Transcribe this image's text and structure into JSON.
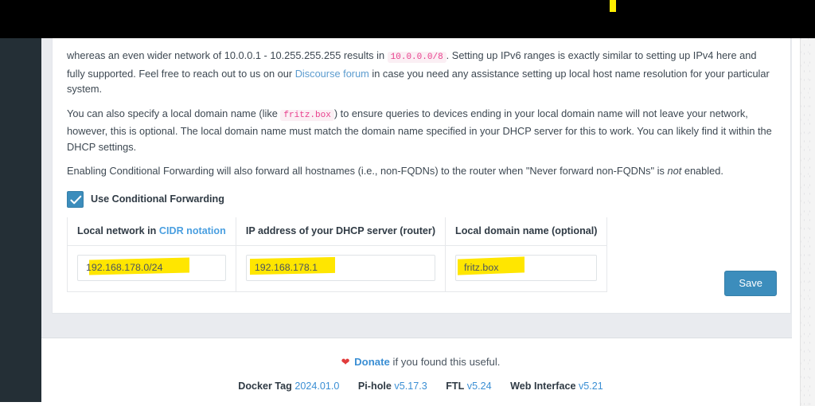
{
  "window": {
    "top_bar_color": "#000000",
    "highlight_color": "#ffe600",
    "sidebar_color": "#242f36",
    "accent_color": "#3c8dbc",
    "link_color": "#3b8fd4"
  },
  "content": {
    "paragraph1_part1": "whereas an even wider network of 10.0.0.1 - 10.255.255.255 results in",
    "paragraph1_code": "10.0.0.0/8",
    "paragraph1_part2": ". Setting up IPv6 ranges is exactly similar to setting up IPv4 here and fully supported. Feel free to reach out to us on our",
    "paragraph1_link": "Discourse forum",
    "paragraph1_part3": "in case you need any assistance setting up local host name resolution for your particular system.",
    "paragraph2_part1": "You can also specify a local domain name (like",
    "paragraph2_code": "fritz.box",
    "paragraph2_part2": ") to ensure queries to devices ending in your local domain name will not leave your network, however, this is optional. The local domain name must match the domain name specified in your DHCP server for this to work. You can likely find it within the DHCP settings.",
    "paragraph3_part1": "Enabling Conditional Forwarding will also forward all hostnames (i.e., non-FQDNs) to the router when \"Never forward non-FQDNs\" is",
    "paragraph3_emphasis": "not",
    "paragraph3_part2": "enabled."
  },
  "conditional_forwarding": {
    "checkbox_label": "Use Conditional Forwarding",
    "checkbox_checked": true,
    "checkbox_icon": "check-icon",
    "columns": [
      {
        "header_prefix": "Local network in",
        "header_link": "CIDR notation",
        "value": "192.168.178.0/24"
      },
      {
        "header_prefix": "IP address of your DHCP server (router)",
        "header_link": "",
        "value": "192.168.178.1"
      },
      {
        "header_prefix": "Local domain name (optional)",
        "header_link": "",
        "value": "fritz.box"
      }
    ]
  },
  "actions": {
    "save_label": "Save"
  },
  "footer": {
    "heart_icon": "heart-icon",
    "donate_label": "Donate",
    "donate_suffix": "if you found this useful.",
    "versions": [
      {
        "name": "Docker Tag",
        "value": "2024.01.0"
      },
      {
        "name": "Pi-hole",
        "value": "v5.17.3"
      },
      {
        "name": "FTL",
        "value": "v5.24"
      },
      {
        "name": "Web Interface",
        "value": "v5.21"
      }
    ]
  }
}
